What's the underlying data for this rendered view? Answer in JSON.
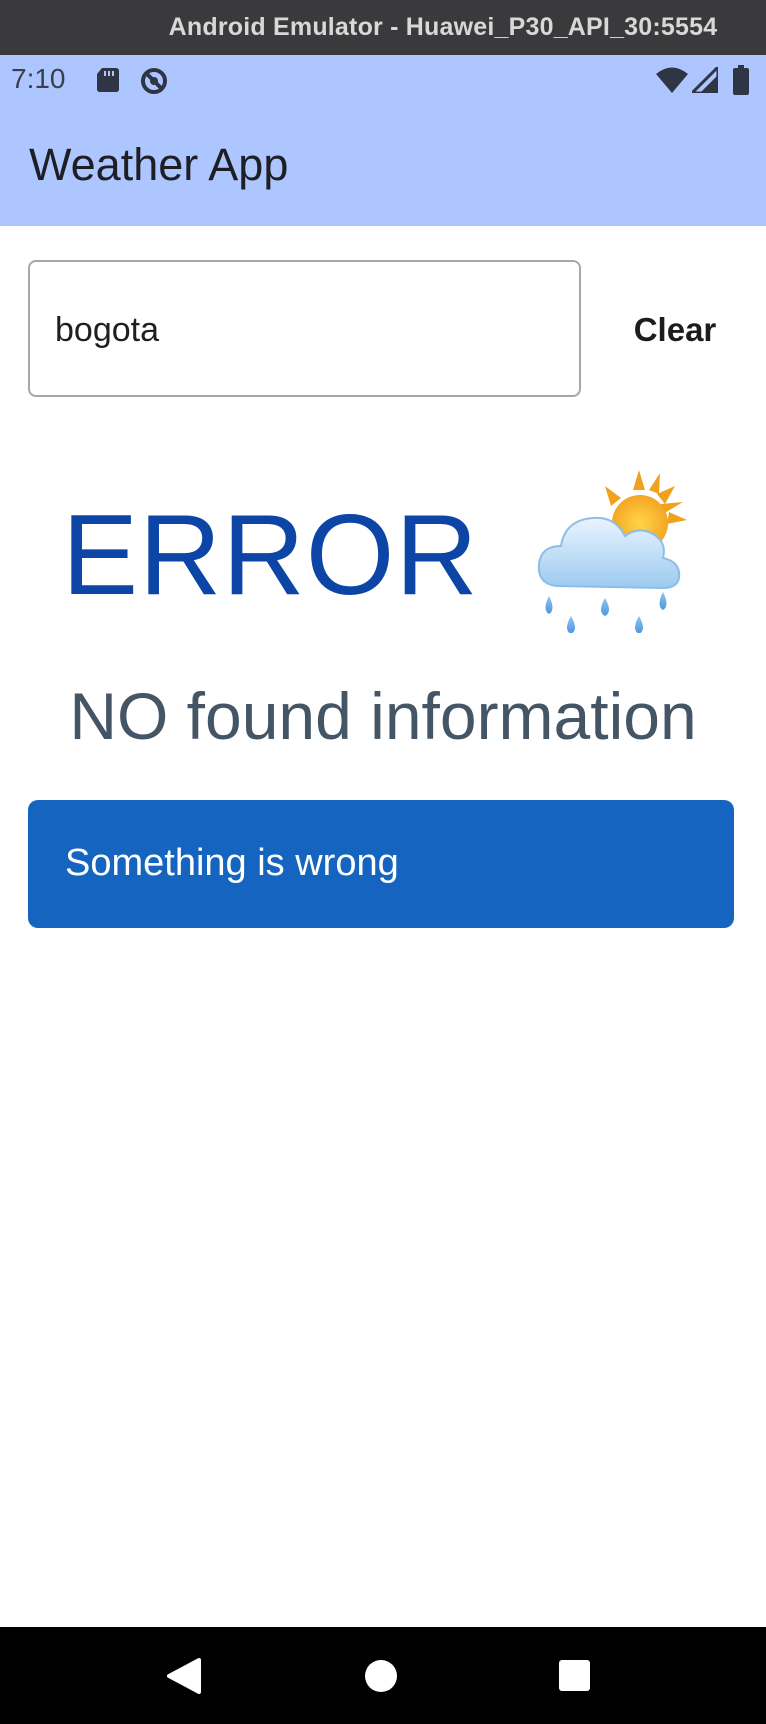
{
  "window": {
    "title": "Android Emulator - Huawei_P30_API_30:5554"
  },
  "status_bar": {
    "time": "7:10",
    "icons": [
      "sd-card-icon",
      "block-icon",
      "wifi-icon",
      "signal-icon",
      "battery-icon"
    ]
  },
  "app_bar": {
    "title": "Weather App"
  },
  "search": {
    "value": "bogota",
    "clear_label": "Clear"
  },
  "result": {
    "status": "ERROR",
    "weather_icon": "cloud-rain-sun-icon",
    "message": "NO found information"
  },
  "banner": {
    "text": "Something is wrong"
  },
  "nav_bar": {
    "icons": [
      "back-icon",
      "home-icon",
      "recents-icon"
    ]
  },
  "colors": {
    "app_bar": "#aec6ff",
    "error_text": "#0c45a5",
    "info_text": "#445566",
    "banner": "#1565c0"
  }
}
